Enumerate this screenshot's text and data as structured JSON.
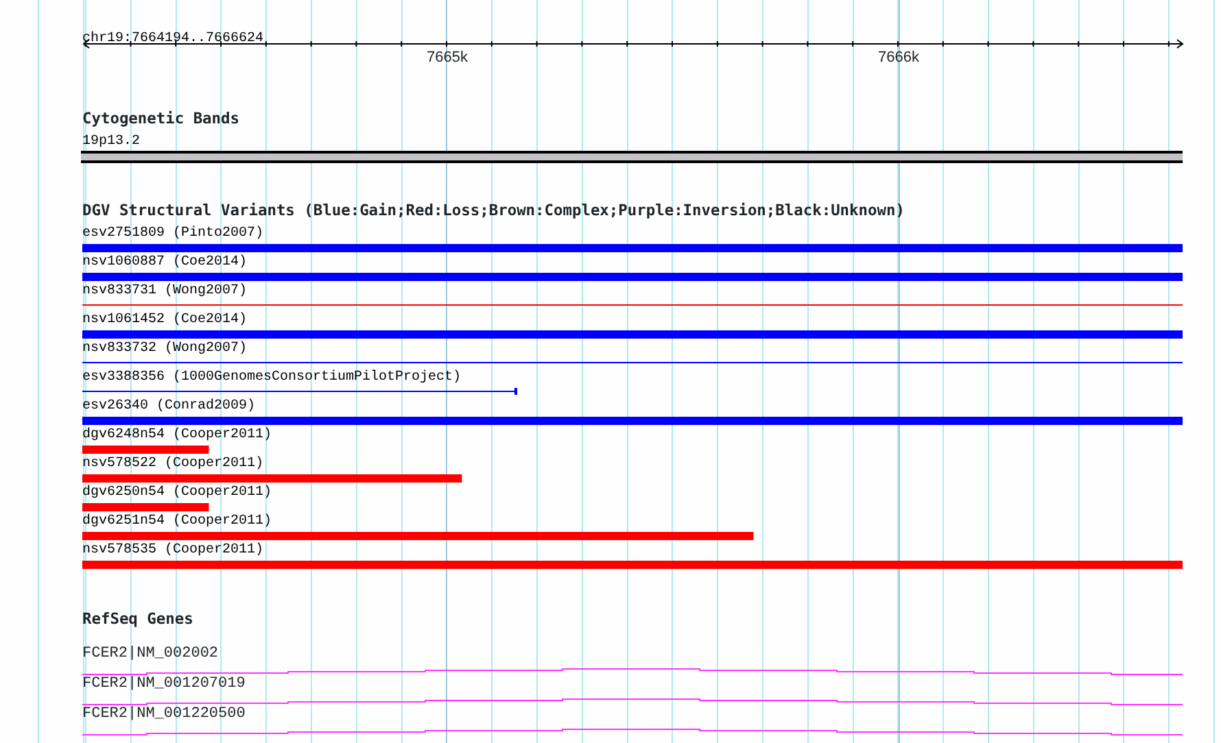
{
  "ruler": {
    "location": "chr19:7664194..7666624",
    "tick_labels": [
      "7665k",
      "7666k"
    ]
  },
  "tracks": [
    {
      "title": "Cytogenetic Bands",
      "kind": "bands",
      "features": [
        {
          "label": "19p13.2"
        }
      ]
    },
    {
      "title": "DGV Structural Variants (Blue:Gain;Red:Loss;Brown:Complex;Purple:Inversion;Black:Unknown)",
      "kind": "variants",
      "features": [
        {
          "label": "esv2751809 (Pinto2007)",
          "kind": "thick",
          "color": "#0000ff",
          "level": 1
        },
        {
          "label": "nsv1060887 (Coe2014)",
          "kind": "thick",
          "color": "#0000ff",
          "level": 1
        },
        {
          "label": "nsv833731 (Wong2007)",
          "kind": "thin",
          "color": "#ff0000",
          "level": 1
        },
        {
          "label": "nsv1061452 (Coe2014)",
          "kind": "thick",
          "color": "#0000ff",
          "level": 1
        },
        {
          "label": "nsv833732 (Wong2007)",
          "kind": "thin",
          "color": "#0000ff",
          "level": 1
        },
        {
          "label": "esv3388356 (1000GenomesConsortiumPilotProject)",
          "kind": "capped",
          "color": "#0000ff",
          "level": 0.394
        },
        {
          "label": "esv26340 (Conrad2009)",
          "kind": "thick",
          "color": "#0000ff",
          "level": 1
        },
        {
          "label": "dgv6248n54 (Cooper2011)",
          "kind": "thick",
          "color": "#ff0000",
          "level": 0.115
        },
        {
          "label": "nsv578522 (Cooper2011)",
          "kind": "thick",
          "color": "#ff0000",
          "level": 0.345
        },
        {
          "label": "dgv6250n54 (Cooper2011)",
          "kind": "thick",
          "color": "#ff0000",
          "level": 0.115
        },
        {
          "label": "dgv6251n54 (Cooper2011)",
          "kind": "thick",
          "color": "#ff0000",
          "level": 0.61
        },
        {
          "label": "nsv578535 (Cooper2011)",
          "kind": "thick",
          "color": "#ff0000",
          "level": 1
        }
      ]
    },
    {
      "title": "RefSeq Genes",
      "kind": "genes",
      "features": [
        {
          "label": "FCER2|NM_002002"
        },
        {
          "label": "FCER2|NM_001207019"
        },
        {
          "label": "FCER2|NM_001220500"
        }
      ]
    }
  ]
}
